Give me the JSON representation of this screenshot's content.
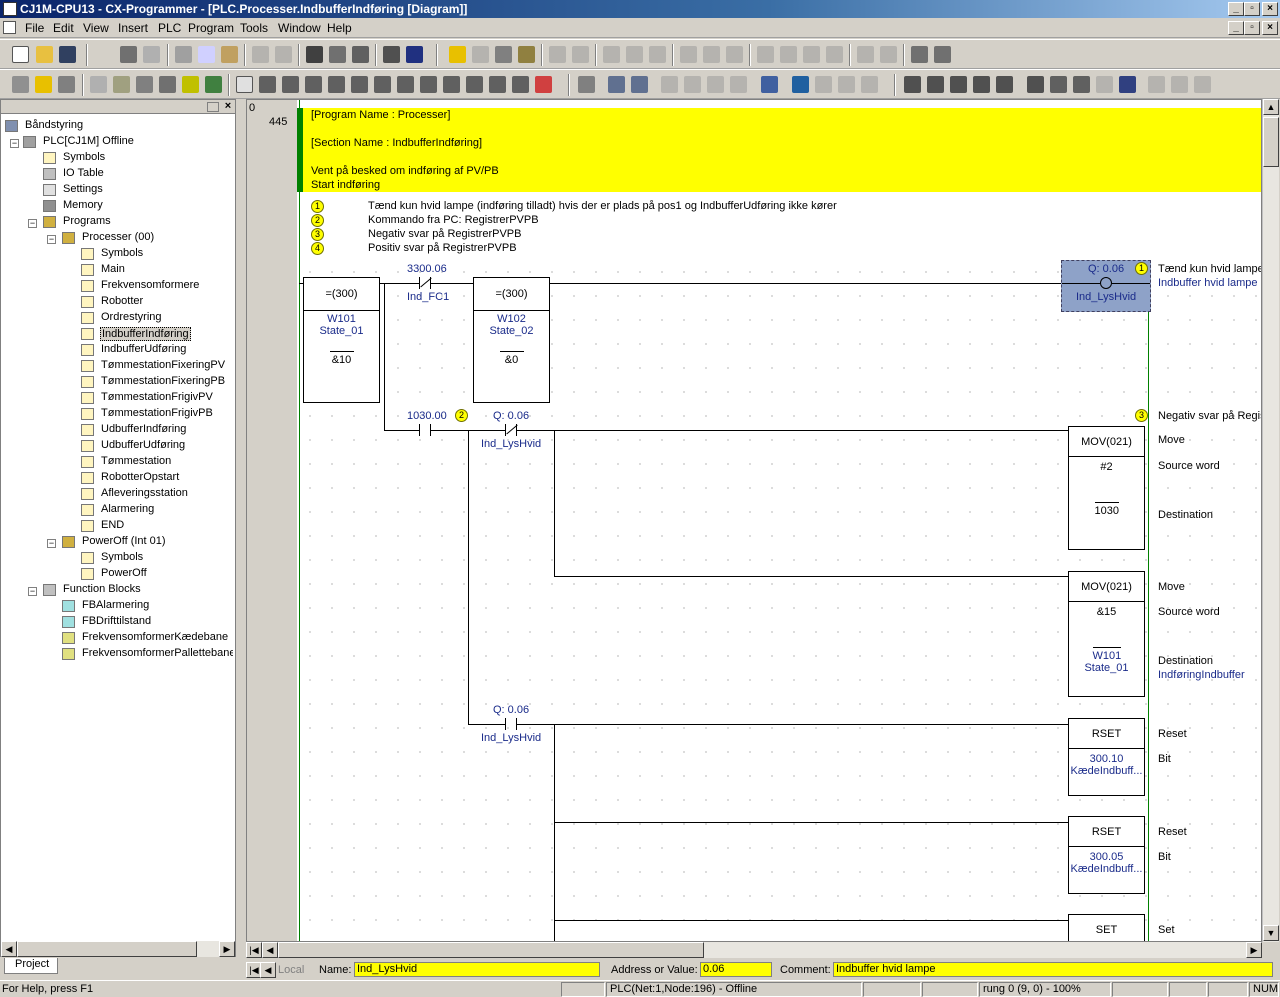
{
  "window": {
    "title": "CJ1M-CPU13 - CX-Programmer - [PLC.Processer.IndbufferIndføring [Diagram]]"
  },
  "menu": [
    "File",
    "Edit",
    "View",
    "Insert",
    "PLC",
    "Program",
    "Tools",
    "Window",
    "Help"
  ],
  "project": {
    "root": "Båndstyring",
    "plc": "PLC[CJ1M] Offline",
    "symbols": "Symbols",
    "io_table": "IO Table",
    "settings": "Settings",
    "memory": "Memory",
    "programs": "Programs",
    "processer": "Processer (00)",
    "sections": [
      "Symbols",
      "Main",
      "Frekvensomformere",
      "Robotter",
      "Ordrestyring",
      "IndbufferIndføring",
      "IndbufferUdføring",
      "TømmestationFixeringPV",
      "TømmestationFixeringPB",
      "TømmestationFrigivPV",
      "TømmestationFrigivPB",
      "UdbufferIndføring",
      "UdbufferUdføring",
      "Tømmestation",
      "RobotterOpstart",
      "Afleveringsstation",
      "Alarmering",
      "END"
    ],
    "poweroff": "PowerOff (Int 01)",
    "poweroff_sections": [
      "Symbols",
      "PowerOff"
    ],
    "function_blocks": "Function Blocks",
    "fbs": [
      "FBAlarmering",
      "FBDrifttilstand",
      "FrekvensomformerKædebane",
      "FrekvensomformerPallettebane"
    ],
    "tab": "Project"
  },
  "diagram": {
    "rung_start": "0",
    "rung_address": "445",
    "program_name": "[Program Name : Processer]",
    "section_name": "[Section Name : IndbufferIndføring]",
    "rung_comment_1": "Vent på besked om indføring af PV/PB",
    "rung_comment_2": "Start indføring",
    "comments": [
      {
        "num": "1",
        "text": "Tænd kun hvid lampe (indføring tilladt) hvis der er plads på pos1 og IndbufferUdføring ikke kører"
      },
      {
        "num": "2",
        "text": "Kommando fra PC: RegistrerPVPB"
      },
      {
        "num": "3",
        "text": "Negativ svar på RegistrerPVPB"
      },
      {
        "num": "4",
        "text": "Positiv svar på RegistrerPVPB"
      }
    ],
    "cmp1": {
      "op": "=(300)",
      "a": "W101",
      "a2": "State_01",
      "b": "&10"
    },
    "contact1": {
      "addr": "3300.06",
      "name": "Ind_FC1"
    },
    "cmp2": {
      "op": "=(300)",
      "a": "W102",
      "a2": "State_02",
      "b": "&0"
    },
    "coil1": {
      "addr": "Q: 0.06",
      "name": "Ind_LysHvid",
      "num": "1",
      "c1": "Tænd kun hvid lampe",
      "c2": "Indbuffer hvid lampe"
    },
    "contact2": {
      "addr": "1030.00",
      "num": "2"
    },
    "contact3": {
      "addr": "Q: 0.06",
      "name": "Ind_LysHvid"
    },
    "mov1": {
      "op": "MOV(021)",
      "src": "#2",
      "dst": "1030",
      "num": "3",
      "c": "Negativ svar på Regis",
      "l1": "Move",
      "l2": "Source word",
      "l3": "Destination"
    },
    "mov2": {
      "op": "MOV(021)",
      "src": "&15",
      "dst": "W101",
      "dst2": "State_01",
      "l1": "Move",
      "l2": "Source word",
      "l3": "Destination",
      "l4": "IndføringIndbuffer"
    },
    "contact4": {
      "addr": "Q: 0.06",
      "name": "Ind_LysHvid"
    },
    "rset1": {
      "op": "RSET",
      "bit": "300.10",
      "bit2": "KædeIndbuff...",
      "l1": "Reset",
      "l2": "Bit"
    },
    "rset2": {
      "op": "RSET",
      "bit": "300.05",
      "bit2": "KædeIndbuff...",
      "l1": "Reset",
      "l2": "Bit"
    },
    "set1": {
      "op": "SET",
      "l1": "Set"
    }
  },
  "infobar": {
    "local": "Local",
    "name_label": "Name:",
    "name_value": "Ind_LysHvid",
    "addr_label": "Address or Value:",
    "addr_value": "0.06",
    "comment_label": "Comment:",
    "comment_value": "Indbuffer hvid lampe"
  },
  "statusbar": {
    "help": "For Help, press F1",
    "plc": "PLC(Net:1,Node:196) - Offline",
    "rung": "rung 0 (9, 0)  - 100%",
    "num": "NUM"
  },
  "colors": {
    "title_bar": "#0a246a",
    "comment_band": "#ffff00",
    "power_rail": "#008000",
    "selection": "#8ea2c8"
  }
}
